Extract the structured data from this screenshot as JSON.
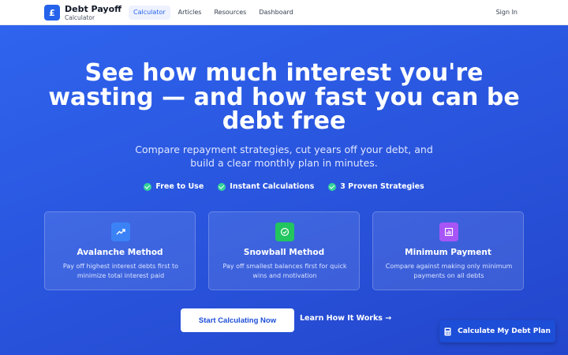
{
  "navbar": {
    "logo_glyph": "£",
    "brand_title": "Debt Payoff",
    "brand_subtitle": "Calculator",
    "links": [
      {
        "label": "Calculator",
        "active": true
      },
      {
        "label": "Articles",
        "active": false
      },
      {
        "label": "Resources",
        "active": false
      },
      {
        "label": "Dashboard",
        "active": false
      }
    ],
    "sign_in": "Sign In"
  },
  "hero": {
    "headline": "See how much interest you're wasting — and how fast you can be debt free",
    "subhead": "Compare repayment strategies, cut years off your debt, and build a clear monthly plan in minutes.",
    "badges": [
      "Free to Use",
      "Instant Calculations",
      "3 Proven Strategies"
    ],
    "cards": [
      {
        "icon": "trending-up-icon",
        "color": "#3b82f6",
        "title": "Avalanche Method",
        "desc": "Pay off highest interest debts first to minimize total interest paid"
      },
      {
        "icon": "check-circle-icon",
        "color": "#22c55e",
        "title": "Snowball Method",
        "desc": "Pay off smallest balances first for quick wins and motivation"
      },
      {
        "icon": "bar-chart-icon",
        "color": "#a855f7",
        "title": "Minimum Payment",
        "desc": "Compare against making only minimum payments on all debts"
      }
    ],
    "primary_cta": "Start Calculating Now",
    "secondary_cta": "Learn How It Works →"
  },
  "fab": {
    "icon": "calculator-icon",
    "label": "Calculate My Debt Plan"
  },
  "colors": {
    "brand": "#2563eb",
    "hero_bg": "#2b5ce6",
    "check": "#34d399"
  }
}
